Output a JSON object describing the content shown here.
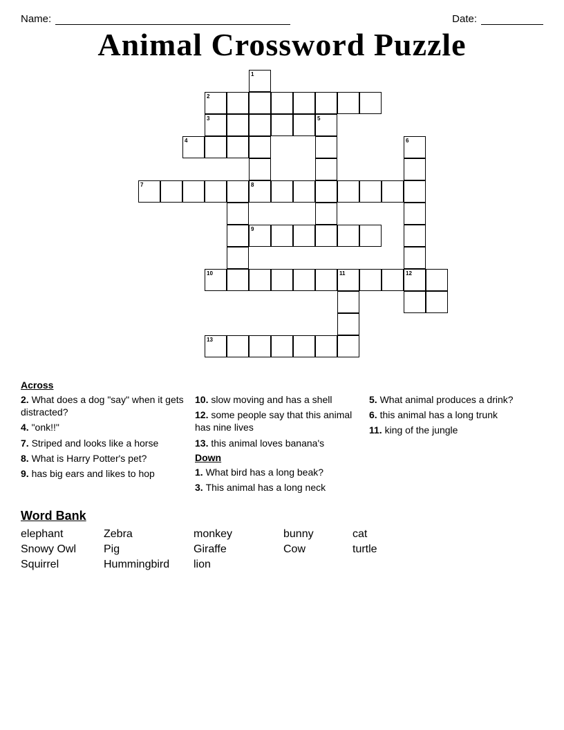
{
  "header": {
    "name_label": "Name:",
    "date_label": "Date:"
  },
  "title": "Animal Crossword Puzzle",
  "clues": {
    "across_label": "Across",
    "across": [
      {
        "num": "2",
        "text": "What does a dog \"say\" when it gets distracted?"
      },
      {
        "num": "4",
        "text": "\"onk!!\""
      },
      {
        "num": "7",
        "text": "Striped and looks like a horse"
      },
      {
        "num": "8",
        "text": "What is Harry Potter's pet?"
      },
      {
        "num": "9",
        "text": "has big ears and likes to hop"
      },
      {
        "num": "10",
        "text": "slow moving and has a shell"
      },
      {
        "num": "12",
        "text": "some people say that this animal has nine lives"
      },
      {
        "num": "13",
        "text": "this animal loves banana's"
      }
    ],
    "down_label": "Down",
    "down": [
      {
        "num": "1",
        "text": "What bird has a long beak?"
      },
      {
        "num": "3",
        "text": "This animal has a long neck"
      },
      {
        "num": "5",
        "text": "What animal produces a drink?"
      },
      {
        "num": "6",
        "text": "this animal has a long trunk"
      },
      {
        "num": "11",
        "text": "king of the jungle"
      }
    ]
  },
  "word_bank": {
    "title": "Word Bank",
    "words": [
      [
        "elephant",
        "Zebra",
        "monkey",
        "bunny",
        "cat"
      ],
      [
        "Snowy Owl",
        "Pig",
        "Giraffe",
        "Cow",
        "turtle"
      ],
      [
        "Squirrel",
        "Hummingbird",
        "lion",
        "",
        ""
      ]
    ]
  }
}
